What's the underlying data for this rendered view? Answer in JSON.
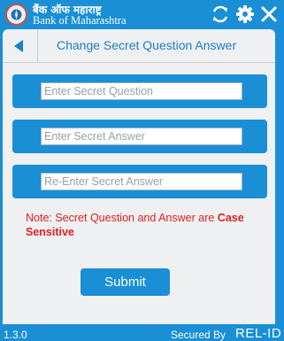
{
  "header": {
    "bank_name_hindi": "बैंक ऑफ महाराष्ट्र",
    "bank_name_english": "Bank of Maharashtra",
    "icons": [
      "refresh-icon",
      "gear-icon",
      "close-icon"
    ]
  },
  "title_bar": {
    "title": "Change Secret Question Answer"
  },
  "form": {
    "question_placeholder": "Enter Secret Question",
    "answer_placeholder": "Enter Secret Answer",
    "reenter_placeholder": "Re-Enter Secret Answer",
    "note_prefix": "Note: Secret Question and Answer are ",
    "note_emphasis": "Case Sensitive",
    "submit_label": "Submit"
  },
  "footer": {
    "version": "1.3.0",
    "secured_by": "Secured By",
    "brand": "REL-ID"
  },
  "colors": {
    "primary_blue": "#1a8fd6",
    "panel_bg": "#eef0f2",
    "title_text": "#1a7fc4",
    "note_red": "#e02020"
  }
}
